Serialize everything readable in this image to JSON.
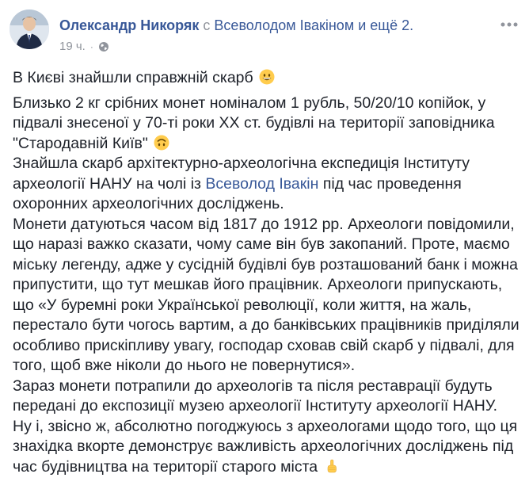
{
  "header": {
    "author": "Олександр Никоряк",
    "with_text": "с",
    "tagged_person": "Всеволодом Івакіном",
    "others_text": "и ещё 2.",
    "timestamp": "19 ч.",
    "separator": "·",
    "privacy_icon": "globe-icon",
    "more_icon": "more-options-icon"
  },
  "post": {
    "title_text": "В Києві знайшли справжній скарб",
    "title_emoji": "grinning-face-emoji",
    "paragraph_1": "Близько 2 кг срібних монет номіналом 1 рубль, 50/20/10 копійок, у підвалі знесеної у 70-ті роки ХХ ст. будівлі на території заповідника \"Стародавній Київ\"",
    "paragraph_1_emoji": "upside-down-face-emoji",
    "paragraph_2_before": "Знайшла скарб архітектурно-археологічна експедиція Інституту археології НАНУ на чолі із",
    "paragraph_2_link": "Всеволод Івакін",
    "paragraph_2_after": "під час проведення охоронних археологічних досліджень.",
    "paragraph_3": "Монети датуються часом від 1817 до 1912 рр. Археологи повідомили, що наразі важко сказати, чому саме він був закопаний. Проте, маємо міську легенду, адже у сусідній будівлі був розташований банк і можна припустити, що тут мешкав його працівник. Археологи припускають, що «У буремні роки Української революції, коли життя, на жаль, перестало бути чогось вартим, а до банківських працівників приділяли особливо прискіпливу увагу, господар сховав свій скарб у підвалі, для того, щоб вже ніколи до нього не повернутися».",
    "paragraph_4": "Зараз монети потрапили до археологів та після реставрації будуть передані до експозиції музею археології Інституту археології НАНУ.",
    "paragraph_5": "Ну і, звісно ж, абсолютно погоджуюсь з археологами щодо того, що ця знахідка вкорте демонструє важливість археологічних досліджень під час будівництва на території старого міста",
    "paragraph_5_emoji": "pointing-up-emoji"
  },
  "colors": {
    "link": "#385898",
    "meta": "#90949c",
    "text": "#1d2129"
  }
}
